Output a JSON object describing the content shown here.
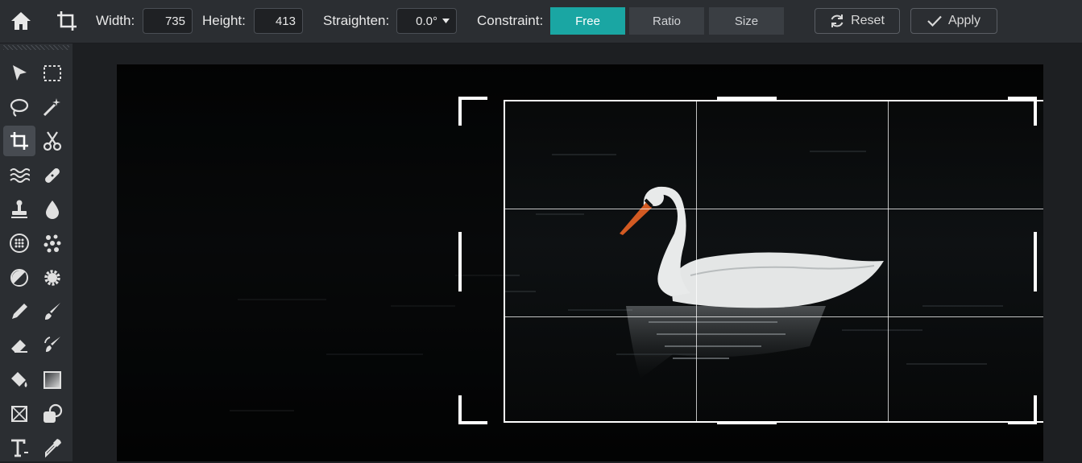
{
  "toolbar_top": {
    "width_label": "Width:",
    "width_value": "735",
    "height_label": "Height:",
    "height_value": "413",
    "straighten_label": "Straighten:",
    "straighten_value": "0.0°",
    "constraint_label": "Constraint:",
    "constraint_options": [
      "Free",
      "Ratio",
      "Size"
    ],
    "constraint_selected": "Free",
    "reset_label": "Reset",
    "apply_label": "Apply"
  },
  "tools": [
    "select-arrow",
    "marquee",
    "lasso",
    "magic-wand",
    "crop",
    "cut",
    "liquify",
    "heal",
    "clone-stamp",
    "blur",
    "pixelate",
    "color-picker-dots",
    "dodge-burn",
    "sponge",
    "pencil",
    "brush",
    "eraser",
    "replace-color",
    "paint-bucket",
    "gradient",
    "transform",
    "shape",
    "text",
    "eyedropper"
  ],
  "active_tool": "crop",
  "colors": {
    "accent": "#1aa6a3",
    "panel": "#2b2e32",
    "workspace": "#1d1f22"
  }
}
